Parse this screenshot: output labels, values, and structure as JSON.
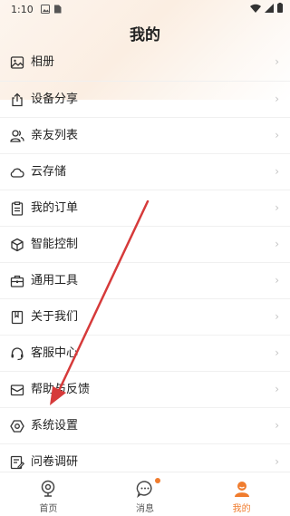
{
  "status_bar": {
    "time": "1:10"
  },
  "header": {
    "title": "我的"
  },
  "menu": {
    "items": [
      {
        "label": "相册",
        "icon": "photo-album-icon"
      },
      {
        "label": "设备分享",
        "icon": "share-icon"
      },
      {
        "label": "亲友列表",
        "icon": "contacts-icon"
      },
      {
        "label": "云存储",
        "icon": "cloud-icon"
      },
      {
        "label": "我的订单",
        "icon": "order-icon"
      },
      {
        "label": "智能控制",
        "icon": "cube-icon"
      },
      {
        "label": "通用工具",
        "icon": "toolbox-icon"
      },
      {
        "label": "关于我们",
        "icon": "bookmark-icon"
      },
      {
        "label": "客服中心",
        "icon": "headset-icon"
      },
      {
        "label": "帮助与反馈",
        "icon": "mail-icon"
      },
      {
        "label": "系统设置",
        "icon": "settings-icon"
      },
      {
        "label": "问卷调研",
        "icon": "survey-icon"
      }
    ]
  },
  "tabbar": {
    "tabs": [
      {
        "label": "首页",
        "icon": "camera-icon",
        "active": false
      },
      {
        "label": "消息",
        "icon": "message-icon",
        "active": false
      },
      {
        "label": "我的",
        "icon": "user-icon",
        "active": true
      }
    ]
  },
  "colors": {
    "accent": "#f07c2e",
    "annotation_arrow": "#d63a3a"
  }
}
